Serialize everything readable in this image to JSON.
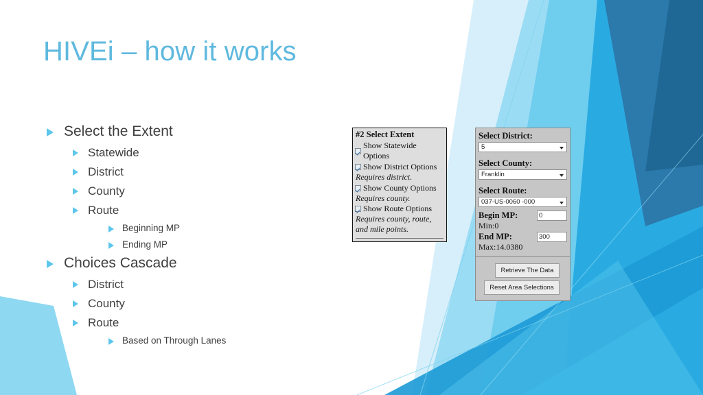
{
  "slide": {
    "title": "HIVEi – how it works"
  },
  "outline": [
    {
      "level": 1,
      "text": "Select the Extent"
    },
    {
      "level": 2,
      "text": "Statewide"
    },
    {
      "level": 2,
      "text": "District"
    },
    {
      "level": 2,
      "text": "County"
    },
    {
      "level": 2,
      "text": "Route"
    },
    {
      "level": 3,
      "text": "Beginning MP"
    },
    {
      "level": 3,
      "text": "Ending MP"
    },
    {
      "level": 1,
      "text": "Choices Cascade"
    },
    {
      "level": 2,
      "text": "District"
    },
    {
      "level": 2,
      "text": "County"
    },
    {
      "level": 2,
      "text": "Route"
    },
    {
      "level": 3,
      "text": "Based on Through Lanes"
    }
  ],
  "extent_panel": {
    "header": "#2 Select Extent",
    "items": [
      {
        "label": "Show Statewide Options",
        "checked": true,
        "note": ""
      },
      {
        "label": "Show District Options",
        "checked": true,
        "note": "Requires district."
      },
      {
        "label": "Show County Options",
        "checked": true,
        "note": "Requires county."
      },
      {
        "label": "Show Route Options",
        "checked": true,
        "note": "Requires county, route, and mile points."
      }
    ]
  },
  "selection_panel": {
    "district_label": "Select District:",
    "district_value": "5",
    "county_label": "Select County:",
    "county_value": "Franklin",
    "route_label": "Select Route:",
    "route_value": "037-US-0060 -000",
    "begin_mp_label": "Begin MP:",
    "begin_mp_value": "0",
    "begin_mp_min": "Min:0",
    "end_mp_label": "End MP:",
    "end_mp_value": "300",
    "end_mp_max": "Max:14.0380",
    "retrieve_button": "Retrieve The Data",
    "reset_button": "Reset Area Selections"
  },
  "colors": {
    "title": "#5FB9DE",
    "bullet": "#5CC6EB",
    "body_text": "#3f3f3f",
    "art_pale": "#D7EFFA",
    "art_light": "#9BDCF5",
    "art_sky": "#6FCDEE",
    "art_cyan": "#29ABE2",
    "art_blue": "#1C9AD6",
    "art_steel": "#2C79AC",
    "art_deep": "#1F6896",
    "panel_extent_bg": "#dedede",
    "panel_select_bg": "#c6c6c6",
    "button_bg": "#ececec"
  }
}
